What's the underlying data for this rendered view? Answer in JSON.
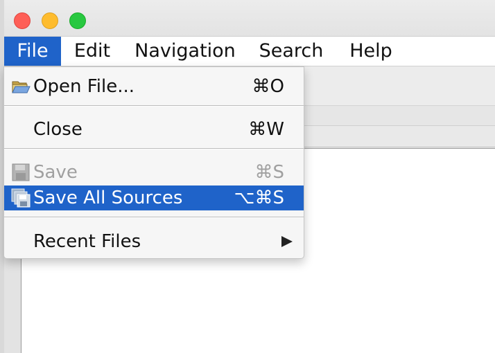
{
  "menubar": {
    "items": [
      {
        "label": "File",
        "active": true
      },
      {
        "label": "Edit"
      },
      {
        "label": "Navigation"
      },
      {
        "label": "Search"
      },
      {
        "label": "Help"
      }
    ]
  },
  "file_menu": {
    "items": [
      {
        "label": "Open File...",
        "shortcut": "⌘O",
        "icon": "folder-open-icon",
        "enabled": true
      },
      {
        "label": "Close",
        "shortcut": "⌘W",
        "enabled": true
      },
      {
        "label": "Save",
        "shortcut": "⌘S",
        "icon": "save-icon",
        "enabled": false
      },
      {
        "label": "Save All Sources",
        "shortcut": "⌥⌘S",
        "icon": "save-all-icon",
        "enabled": true,
        "highlighted": true
      },
      {
        "label": "Recent Files",
        "submenu": true,
        "enabled": true
      }
    ]
  },
  "colors": {
    "highlight": "#1f63c9",
    "close": "#fe5f57",
    "minimize": "#febc2e",
    "maximize": "#28c840"
  }
}
